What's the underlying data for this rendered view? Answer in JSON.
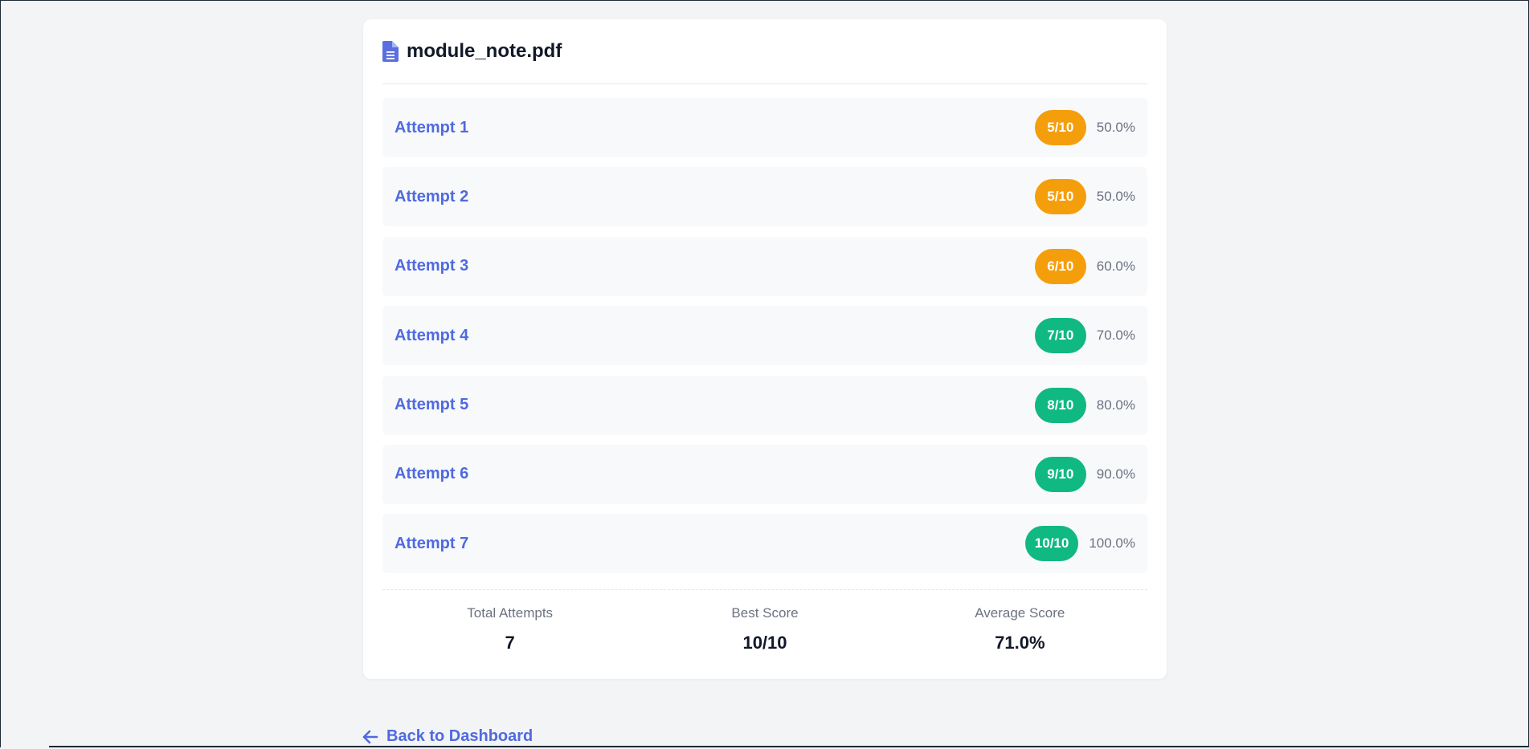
{
  "file": {
    "title": "module_note.pdf",
    "icon": "file-text-icon",
    "icon_color": "#5b6ee1"
  },
  "attempts": [
    {
      "label": "Attempt 1",
      "score": "5/10",
      "percent": "50.0%",
      "color": "#f59e0b"
    },
    {
      "label": "Attempt 2",
      "score": "5/10",
      "percent": "50.0%",
      "color": "#f59e0b"
    },
    {
      "label": "Attempt 3",
      "score": "6/10",
      "percent": "60.0%",
      "color": "#f59e0b"
    },
    {
      "label": "Attempt 4",
      "score": "7/10",
      "percent": "70.0%",
      "color": "#10b981"
    },
    {
      "label": "Attempt 5",
      "score": "8/10",
      "percent": "80.0%",
      "color": "#10b981"
    },
    {
      "label": "Attempt 6",
      "score": "9/10",
      "percent": "90.0%",
      "color": "#10b981"
    },
    {
      "label": "Attempt 7",
      "score": "10/10",
      "percent": "100.0%",
      "color": "#10b981"
    }
  ],
  "stats": {
    "total_label": "Total Attempts",
    "total_value": "7",
    "best_label": "Best Score",
    "best_value": "10/10",
    "avg_label": "Average Score",
    "avg_value": "71.0%"
  },
  "back_link": {
    "label": "Back to Dashboard",
    "icon": "arrow-left-icon"
  },
  "colors": {
    "accent": "#4f6ae0",
    "warning": "#f59e0b",
    "success": "#10b981"
  }
}
